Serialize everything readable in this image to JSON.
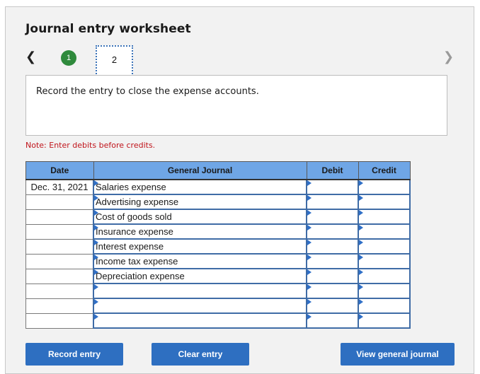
{
  "header": {
    "title": "Journal entry worksheet",
    "steps": [
      {
        "label": "1",
        "status": "completed"
      },
      {
        "label": "2",
        "status": "current"
      }
    ]
  },
  "instruction": "Record the entry to close the expense accounts.",
  "note": "Note: Enter debits before credits.",
  "table": {
    "columns": [
      "Date",
      "General Journal",
      "Debit",
      "Credit"
    ],
    "rows": [
      {
        "date": "Dec. 31, 2021",
        "account": "Salaries expense",
        "debit": "",
        "credit": ""
      },
      {
        "date": "",
        "account": "Advertising expense",
        "debit": "",
        "credit": ""
      },
      {
        "date": "",
        "account": "Cost of goods sold",
        "debit": "",
        "credit": ""
      },
      {
        "date": "",
        "account": "Insurance expense",
        "debit": "",
        "credit": ""
      },
      {
        "date": "",
        "account": "Interest expense",
        "debit": "",
        "credit": ""
      },
      {
        "date": "",
        "account": "Income tax expense",
        "debit": "",
        "credit": ""
      },
      {
        "date": "",
        "account": "Depreciation expense",
        "debit": "",
        "credit": ""
      },
      {
        "date": "",
        "account": "",
        "debit": "",
        "credit": ""
      },
      {
        "date": "",
        "account": "",
        "debit": "",
        "credit": ""
      },
      {
        "date": "",
        "account": "",
        "debit": "",
        "credit": ""
      }
    ]
  },
  "buttons": {
    "record": "Record entry",
    "clear": "Clear entry",
    "view": "View general journal"
  },
  "colors": {
    "accent": "#2e6fc1",
    "header_bg": "#6fa6e6",
    "step_complete": "#2f8a3c",
    "note": "#c0141b"
  }
}
